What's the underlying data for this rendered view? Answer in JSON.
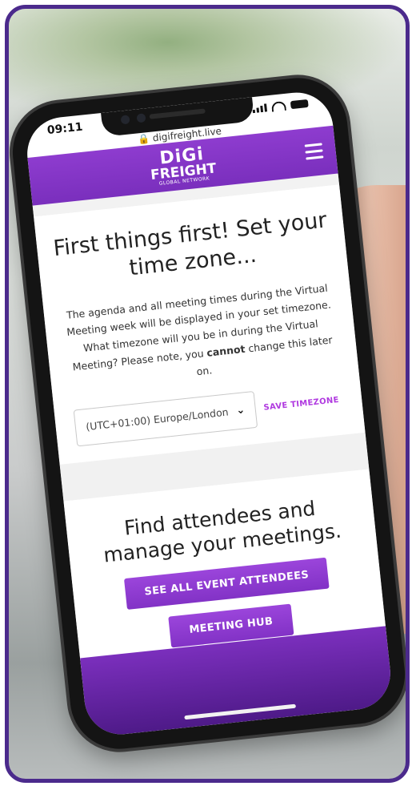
{
  "status": {
    "time": "09:11"
  },
  "url": {
    "domain": "digifreight.live"
  },
  "logo": {
    "top": "DiGi",
    "middle": "FREIGHT",
    "bottom": "GLOBAL NETWORK"
  },
  "timezone_section": {
    "heading": "First things first! Set your time zone...",
    "paragraph_part1": "The agenda and all meeting times during the Virtual Meeting week will be displayed in your set timezone. What timezone will you be in during the Virtual Meeting? Please note, you ",
    "paragraph_bold": "cannot",
    "paragraph_part2": " change this later on.",
    "select_value": "(UTC+01:00) Europe/London",
    "save_label": "SAVE TIMEZONE"
  },
  "attendees_section": {
    "heading": "Find attendees and manage your meetings.",
    "attendees_button": "SEE ALL EVENT ATTENDEES",
    "hub_button": "MEETING HUB"
  },
  "colors": {
    "frame": "#4b2a8c",
    "accent": "#8e3ccf",
    "save_link": "#b03ae0"
  }
}
